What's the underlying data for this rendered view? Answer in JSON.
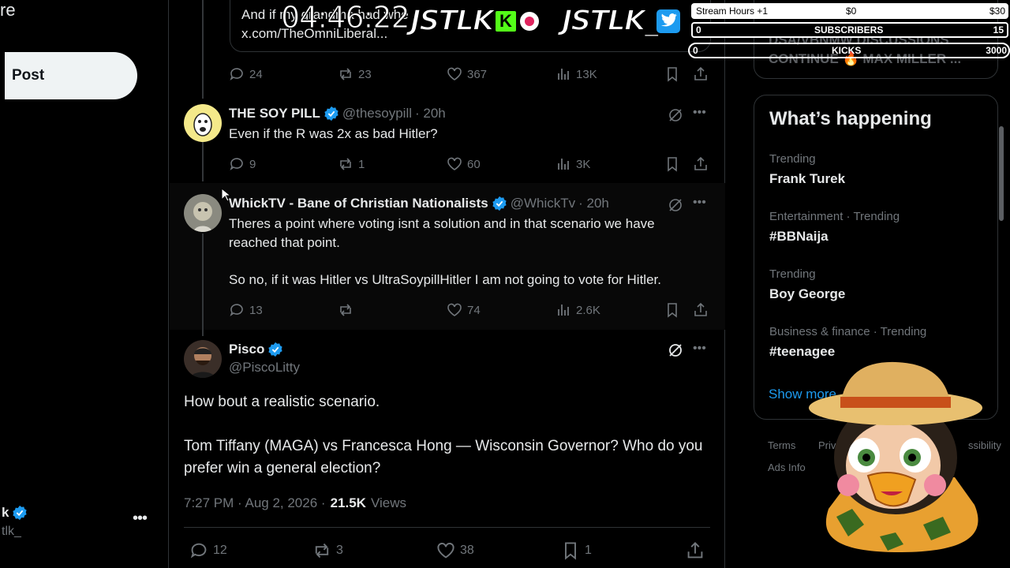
{
  "left_nav": {
    "stub_label": "re",
    "post_label": "Post",
    "account_name_stub": "k",
    "account_handle_stub": "tlk_",
    "more_label": "•••"
  },
  "quote": {
    "text_line1": "And if my grandma had whe",
    "text_line2": "x.com/TheOmniLiberal..."
  },
  "main_actions": {
    "replies": "24",
    "reposts": "23",
    "likes": "367",
    "views": "13K"
  },
  "replies": [
    {
      "name": "THE SOY PILL",
      "handle": "@thesoypill",
      "time": "· 20h",
      "text": "Even if the R was 2x as bad Hitler?",
      "replies": "9",
      "reposts": "1",
      "likes": "60",
      "views": "3K"
    },
    {
      "name": "WhickTV - Bane of Christian Nationalists",
      "handle": "@WhickTv",
      "time": "· 20h",
      "text_p1": "Theres a point where voting isnt a solution and in that scenario we have reached that point.",
      "text_p2": "So no, if it was Hitler vs UltraSoypillHitler I am not going to vote for Hitler.",
      "replies": "13",
      "reposts": "",
      "likes": "74",
      "views": "2.6K"
    }
  ],
  "focus": {
    "name": "Pisco",
    "handle": "@PiscoLitty",
    "text_p1": "How bout a realistic scenario.",
    "text_p2": "Tom Tiffany (MAGA) vs Francesca Hong — Wisconsin Governor? Who do you prefer win a general election?",
    "timestamp": "7:27 PM · Aug 2, 2026 ·",
    "views_count": "21.5K",
    "views_label": "Views",
    "replies": "12",
    "reposts": "3",
    "likes": "38",
    "bookmarks": "1"
  },
  "sidebar": {
    "top_card_line1": "DSA/VBNMW DISCUSSIONS",
    "top_card_line2": "CONTINUE 🔥 MAX MILLER ...",
    "title": "What’s happening",
    "trends": [
      {
        "category": "Trending",
        "name": "Frank Turek"
      },
      {
        "category": "Entertainment · Trending",
        "name": "#BBNaija"
      },
      {
        "category": "Trending",
        "name": "Boy George"
      },
      {
        "category": "Business & finance · Trending",
        "name": "#teenagee"
      }
    ],
    "show_more": "Show more",
    "footer": {
      "terms": "Terms",
      "privacy": "Priv",
      "accessibility": "ssibility",
      "ads": "Ads Info"
    }
  },
  "overlay": {
    "timer": "04:46:22",
    "brand1": "JSTLK",
    "brand1_badge": "K",
    "brand2": "JSTLK_",
    "stream_hours_label": "Stream Hours +1",
    "stream_hours_start": "$0",
    "stream_hours_end": "$30",
    "subs_label": "SUBSCRIBERS",
    "subs_current": "0",
    "subs_goal": "15",
    "kicks_label": "KICKS",
    "kicks_current": "0",
    "kicks_goal": "3000"
  },
  "colors": {
    "accent": "#1d9bf0",
    "bg": "#000000",
    "muted": "#71767b",
    "border": "#2f3336",
    "kick_green": "#53fc18"
  }
}
